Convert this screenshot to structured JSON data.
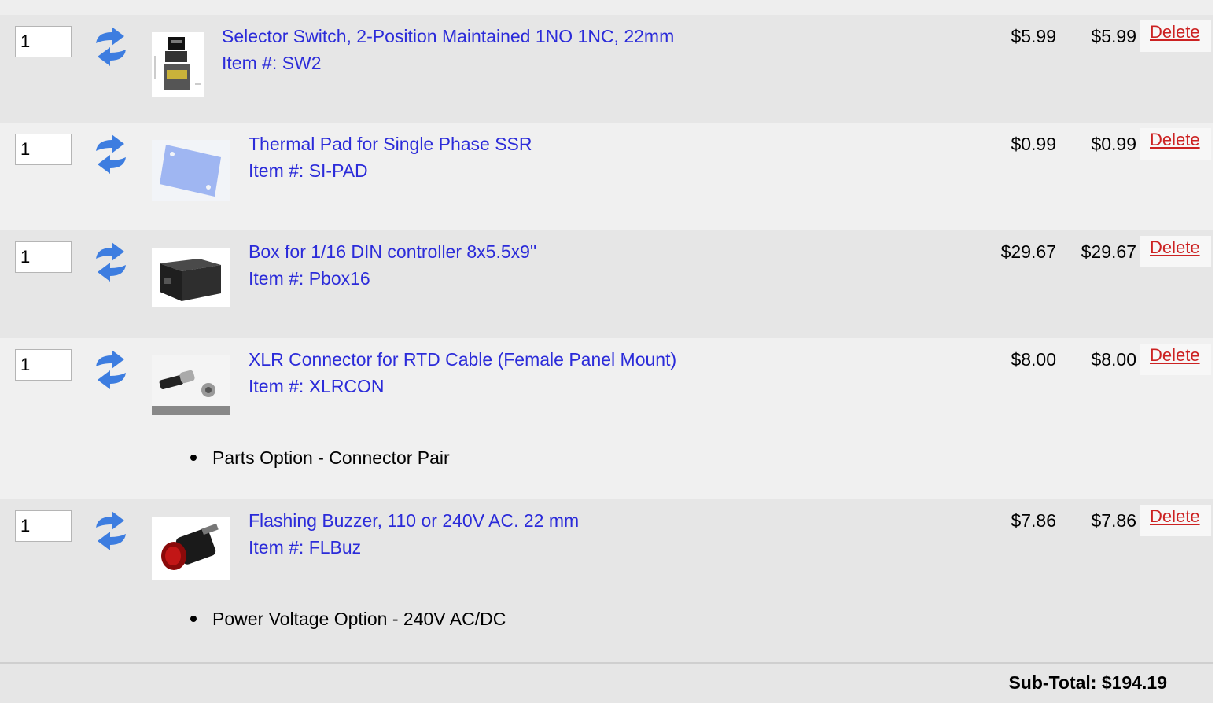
{
  "cart": {
    "items": [
      {
        "qty": "1",
        "title": "Selector Switch, 2-Position Maintained 1NO 1NC, 22mm",
        "sku": "Item #: SW2",
        "price": "$5.99",
        "total": "$5.99",
        "delete": "Delete",
        "option": "",
        "image_icon": "selector-switch-image"
      },
      {
        "qty": "1",
        "title": "Thermal Pad for Single Phase SSR",
        "sku": "Item #: SI-PAD",
        "price": "$0.99",
        "total": "$0.99",
        "delete": "Delete",
        "option": "",
        "image_icon": "thermal-pad-image"
      },
      {
        "qty": "1",
        "title": "Box for 1/16 DIN controller 8x5.5x9\"",
        "sku": "Item #: Pbox16",
        "price": "$29.67",
        "total": "$29.67",
        "delete": "Delete",
        "option": "",
        "image_icon": "box-image"
      },
      {
        "qty": "1",
        "title": "XLR Connector for RTD Cable (Female Panel Mount)",
        "sku": "Item #: XLRCON",
        "price": "$8.00",
        "total": "$8.00",
        "delete": "Delete",
        "option": "Parts Option - Connector Pair",
        "image_icon": "xlr-connector-image"
      },
      {
        "qty": "1",
        "title": "Flashing Buzzer, 110 or 240V AC. 22 mm",
        "sku": "Item #: FLBuz",
        "price": "$7.86",
        "total": "$7.86",
        "delete": "Delete",
        "option": "Power Voltage Option - 240V AC/DC",
        "image_icon": "buzzer-image"
      }
    ],
    "subtotal": "Sub-Total: $194.19",
    "colors": {
      "link": "#2b2bd9",
      "delete": "#cc2222",
      "row_dark": "#e6e6e6",
      "row_light": "#f0f0f0",
      "refresh_icon": "#3d7de0"
    }
  }
}
